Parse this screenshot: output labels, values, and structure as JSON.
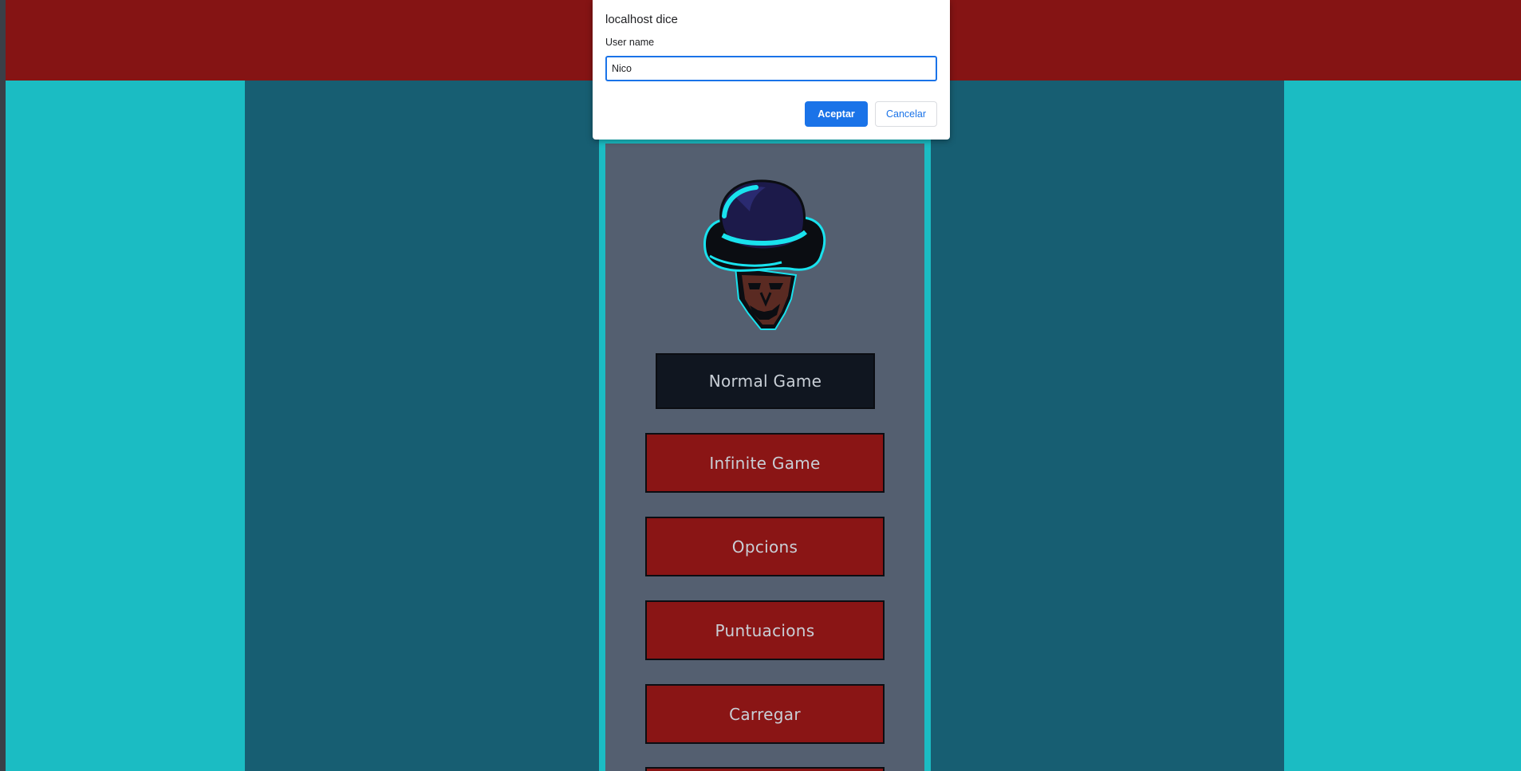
{
  "dialog": {
    "title": "localhost dice",
    "message": "User name",
    "input_value": "Nico",
    "ok_label": "Aceptar",
    "cancel_label": "Cancelar"
  },
  "menu": {
    "logo_icon": "hat-man-logo-icon",
    "buttons": [
      {
        "label": "Normal Game"
      },
      {
        "label": "Infinite Game"
      },
      {
        "label": "Opcions"
      },
      {
        "label": "Puntuacions"
      },
      {
        "label": "Carregar"
      }
    ]
  },
  "colors": {
    "topbar": "#851414",
    "side": "#1bbcc3",
    "center": "#175e72",
    "panel": "#545f70",
    "button_red": "#8a1515",
    "button_dark": "#101620",
    "dialog_accent": "#1a73e8"
  }
}
